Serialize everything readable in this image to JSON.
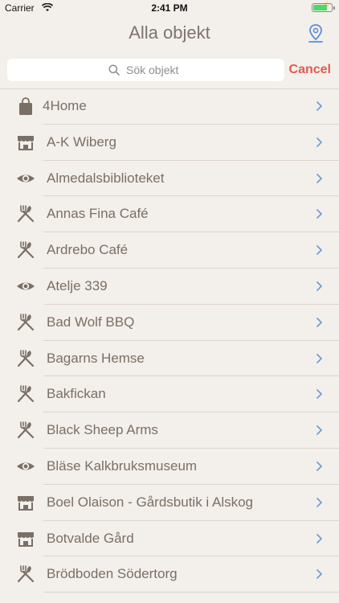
{
  "status": {
    "carrier": "Carrier",
    "time": "2:41 PM"
  },
  "nav": {
    "title": "Alla objekt"
  },
  "search": {
    "placeholder": "Sök objekt",
    "cancel_label": "Cancel"
  },
  "colors": {
    "accent": "#e35a52",
    "icon": "#7a6f66",
    "chevron": "#6a9ad8",
    "background": "#f3efea"
  },
  "items": [
    {
      "label": "4Home",
      "icon": "shopping-bag-icon"
    },
    {
      "label": "A-K Wiberg",
      "icon": "shop-icon"
    },
    {
      "label": "Almedalsbiblioteket",
      "icon": "eye-icon"
    },
    {
      "label": "Annas Fina Café",
      "icon": "restaurant-icon"
    },
    {
      "label": "Ardrebo Café",
      "icon": "restaurant-icon"
    },
    {
      "label": "Atelje 339",
      "icon": "eye-icon"
    },
    {
      "label": "Bad Wolf BBQ",
      "icon": "restaurant-icon"
    },
    {
      "label": "Bagarns Hemse",
      "icon": "restaurant-icon"
    },
    {
      "label": "Bakfickan",
      "icon": "restaurant-icon"
    },
    {
      "label": "Black Sheep Arms",
      "icon": "restaurant-icon"
    },
    {
      "label": "Bläse Kalkbruksmuseum",
      "icon": "eye-icon"
    },
    {
      "label": "Boel Olaison - Gårdsbutik i Alskog",
      "icon": "shop-icon"
    },
    {
      "label": "Botvalde Gård",
      "icon": "shop-icon"
    },
    {
      "label": "Brödboden Södertorg",
      "icon": "restaurant-icon"
    }
  ]
}
